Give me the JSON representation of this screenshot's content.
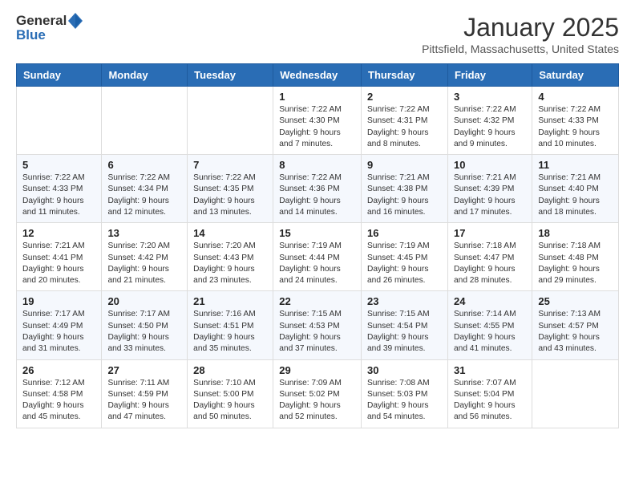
{
  "logo": {
    "general": "General",
    "blue": "Blue"
  },
  "header": {
    "month": "January 2025",
    "location": "Pittsfield, Massachusetts, United States"
  },
  "weekdays": [
    "Sunday",
    "Monday",
    "Tuesday",
    "Wednesday",
    "Thursday",
    "Friday",
    "Saturday"
  ],
  "weeks": [
    [
      {
        "day": "",
        "info": ""
      },
      {
        "day": "",
        "info": ""
      },
      {
        "day": "",
        "info": ""
      },
      {
        "day": "1",
        "info": "Sunrise: 7:22 AM\nSunset: 4:30 PM\nDaylight: 9 hours and 7 minutes."
      },
      {
        "day": "2",
        "info": "Sunrise: 7:22 AM\nSunset: 4:31 PM\nDaylight: 9 hours and 8 minutes."
      },
      {
        "day": "3",
        "info": "Sunrise: 7:22 AM\nSunset: 4:32 PM\nDaylight: 9 hours and 9 minutes."
      },
      {
        "day": "4",
        "info": "Sunrise: 7:22 AM\nSunset: 4:33 PM\nDaylight: 9 hours and 10 minutes."
      }
    ],
    [
      {
        "day": "5",
        "info": "Sunrise: 7:22 AM\nSunset: 4:33 PM\nDaylight: 9 hours and 11 minutes."
      },
      {
        "day": "6",
        "info": "Sunrise: 7:22 AM\nSunset: 4:34 PM\nDaylight: 9 hours and 12 minutes."
      },
      {
        "day": "7",
        "info": "Sunrise: 7:22 AM\nSunset: 4:35 PM\nDaylight: 9 hours and 13 minutes."
      },
      {
        "day": "8",
        "info": "Sunrise: 7:22 AM\nSunset: 4:36 PM\nDaylight: 9 hours and 14 minutes."
      },
      {
        "day": "9",
        "info": "Sunrise: 7:21 AM\nSunset: 4:38 PM\nDaylight: 9 hours and 16 minutes."
      },
      {
        "day": "10",
        "info": "Sunrise: 7:21 AM\nSunset: 4:39 PM\nDaylight: 9 hours and 17 minutes."
      },
      {
        "day": "11",
        "info": "Sunrise: 7:21 AM\nSunset: 4:40 PM\nDaylight: 9 hours and 18 minutes."
      }
    ],
    [
      {
        "day": "12",
        "info": "Sunrise: 7:21 AM\nSunset: 4:41 PM\nDaylight: 9 hours and 20 minutes."
      },
      {
        "day": "13",
        "info": "Sunrise: 7:20 AM\nSunset: 4:42 PM\nDaylight: 9 hours and 21 minutes."
      },
      {
        "day": "14",
        "info": "Sunrise: 7:20 AM\nSunset: 4:43 PM\nDaylight: 9 hours and 23 minutes."
      },
      {
        "day": "15",
        "info": "Sunrise: 7:19 AM\nSunset: 4:44 PM\nDaylight: 9 hours and 24 minutes."
      },
      {
        "day": "16",
        "info": "Sunrise: 7:19 AM\nSunset: 4:45 PM\nDaylight: 9 hours and 26 minutes."
      },
      {
        "day": "17",
        "info": "Sunrise: 7:18 AM\nSunset: 4:47 PM\nDaylight: 9 hours and 28 minutes."
      },
      {
        "day": "18",
        "info": "Sunrise: 7:18 AM\nSunset: 4:48 PM\nDaylight: 9 hours and 29 minutes."
      }
    ],
    [
      {
        "day": "19",
        "info": "Sunrise: 7:17 AM\nSunset: 4:49 PM\nDaylight: 9 hours and 31 minutes."
      },
      {
        "day": "20",
        "info": "Sunrise: 7:17 AM\nSunset: 4:50 PM\nDaylight: 9 hours and 33 minutes."
      },
      {
        "day": "21",
        "info": "Sunrise: 7:16 AM\nSunset: 4:51 PM\nDaylight: 9 hours and 35 minutes."
      },
      {
        "day": "22",
        "info": "Sunrise: 7:15 AM\nSunset: 4:53 PM\nDaylight: 9 hours and 37 minutes."
      },
      {
        "day": "23",
        "info": "Sunrise: 7:15 AM\nSunset: 4:54 PM\nDaylight: 9 hours and 39 minutes."
      },
      {
        "day": "24",
        "info": "Sunrise: 7:14 AM\nSunset: 4:55 PM\nDaylight: 9 hours and 41 minutes."
      },
      {
        "day": "25",
        "info": "Sunrise: 7:13 AM\nSunset: 4:57 PM\nDaylight: 9 hours and 43 minutes."
      }
    ],
    [
      {
        "day": "26",
        "info": "Sunrise: 7:12 AM\nSunset: 4:58 PM\nDaylight: 9 hours and 45 minutes."
      },
      {
        "day": "27",
        "info": "Sunrise: 7:11 AM\nSunset: 4:59 PM\nDaylight: 9 hours and 47 minutes."
      },
      {
        "day": "28",
        "info": "Sunrise: 7:10 AM\nSunset: 5:00 PM\nDaylight: 9 hours and 50 minutes."
      },
      {
        "day": "29",
        "info": "Sunrise: 7:09 AM\nSunset: 5:02 PM\nDaylight: 9 hours and 52 minutes."
      },
      {
        "day": "30",
        "info": "Sunrise: 7:08 AM\nSunset: 5:03 PM\nDaylight: 9 hours and 54 minutes."
      },
      {
        "day": "31",
        "info": "Sunrise: 7:07 AM\nSunset: 5:04 PM\nDaylight: 9 hours and 56 minutes."
      },
      {
        "day": "",
        "info": ""
      }
    ]
  ]
}
